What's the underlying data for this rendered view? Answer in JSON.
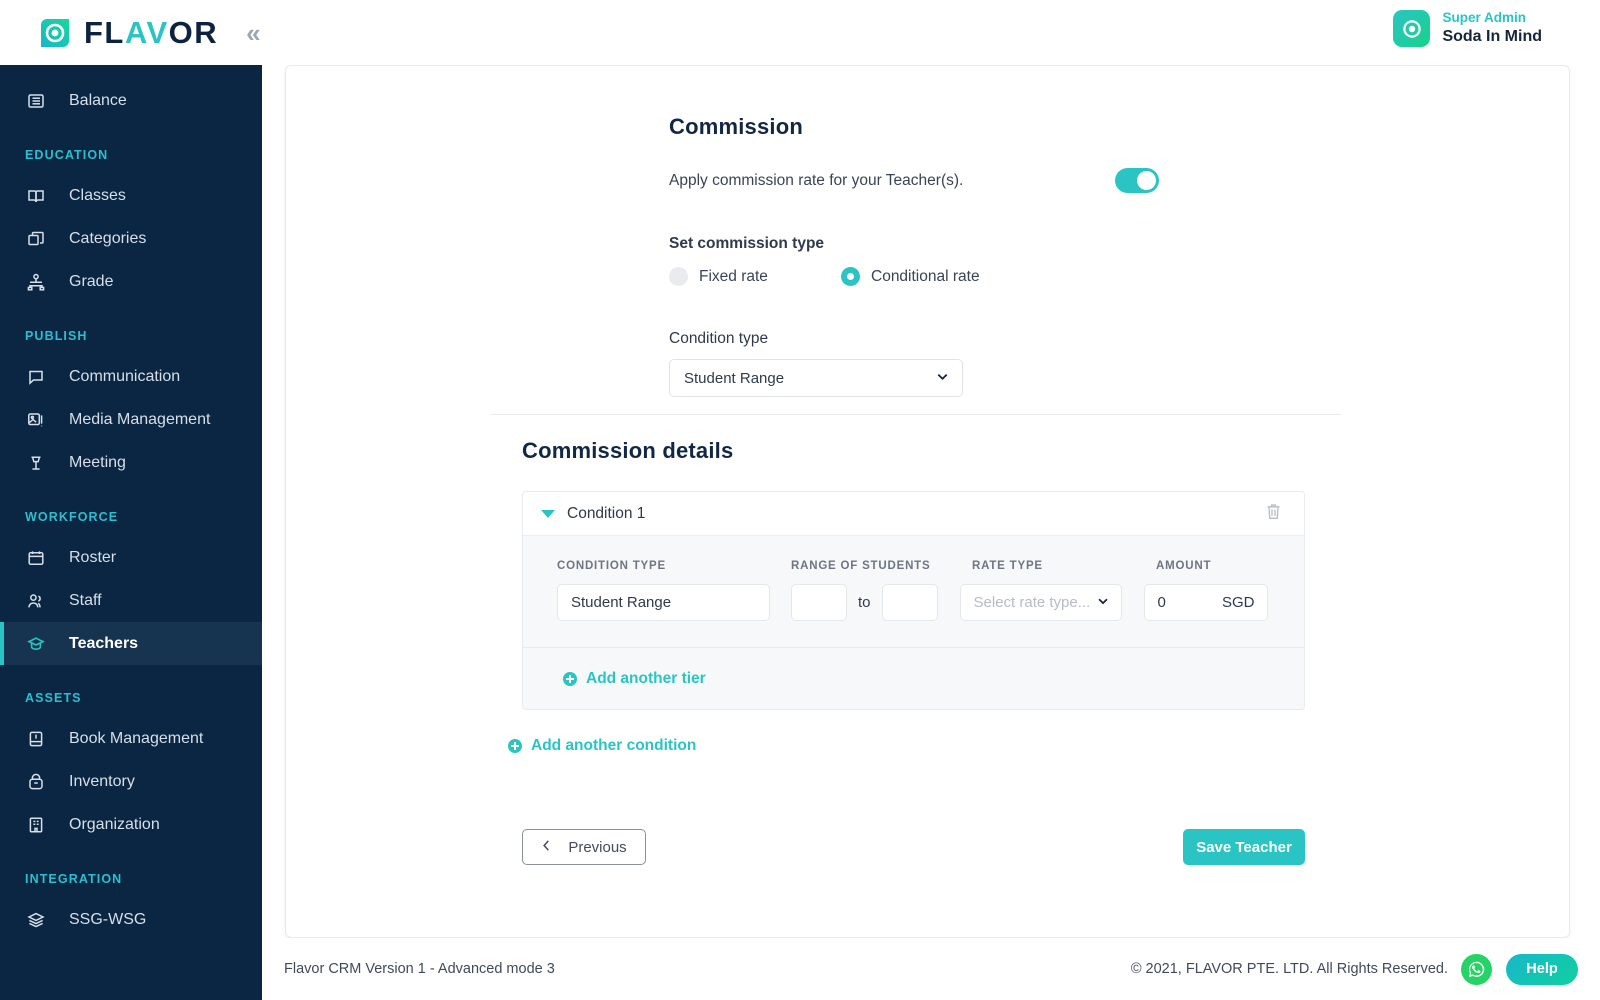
{
  "brand": {
    "name_dark": "FL",
    "name_accent": "AV",
    "name_dark2": "OR",
    "collapse_icon": "«",
    "logo_icon": "flavor-logo-icon"
  },
  "user": {
    "role": "Super Admin",
    "name": "Soda In Mind"
  },
  "sidebar": {
    "items": [
      {
        "label": "Balance",
        "icon": "balance-icon",
        "type": "item",
        "active": false
      },
      {
        "label": "EDUCATION",
        "type": "group"
      },
      {
        "label": "Classes",
        "icon": "classes-icon",
        "type": "item",
        "active": false
      },
      {
        "label": "Categories",
        "icon": "categories-icon",
        "type": "item",
        "active": false
      },
      {
        "label": "Grade",
        "icon": "grade-icon",
        "type": "item",
        "active": false
      },
      {
        "label": "PUBLISH",
        "type": "group"
      },
      {
        "label": "Communication",
        "icon": "communication-icon",
        "type": "item",
        "active": false
      },
      {
        "label": "Media Management",
        "icon": "media-management-icon",
        "type": "item",
        "active": false
      },
      {
        "label": "Meeting",
        "icon": "meeting-icon",
        "type": "item",
        "active": false
      },
      {
        "label": "WORKFORCE",
        "type": "group"
      },
      {
        "label": "Roster",
        "icon": "roster-icon",
        "type": "item",
        "active": false
      },
      {
        "label": "Staff",
        "icon": "staff-icon",
        "type": "item",
        "active": false
      },
      {
        "label": "Teachers",
        "icon": "teachers-icon",
        "type": "item",
        "active": true
      },
      {
        "label": "ASSETS",
        "type": "group"
      },
      {
        "label": "Book Management",
        "icon": "book-management-icon",
        "type": "item",
        "active": false
      },
      {
        "label": "Inventory",
        "icon": "inventory-icon",
        "type": "item",
        "active": false
      },
      {
        "label": "Organization",
        "icon": "organization-icon",
        "type": "item",
        "active": false
      },
      {
        "label": "INTEGRATION",
        "type": "group"
      },
      {
        "label": "SSG-WSG",
        "icon": "ssg-wsg-icon",
        "type": "item",
        "active": false
      }
    ]
  },
  "commission": {
    "title": "Commission",
    "toggle_label": "Apply commission rate for your Teacher(s).",
    "toggle_on": true,
    "type_label": "Set commission type",
    "options": [
      {
        "label": "Fixed rate",
        "selected": false
      },
      {
        "label": "Conditional rate",
        "selected": true
      }
    ],
    "condition_type_label": "Condition type",
    "condition_type_value": "Student Range"
  },
  "details": {
    "title": "Commission details",
    "condition_title": "Condition 1",
    "delete_icon": "trash-icon",
    "columns": {
      "condition_type": "CONDITION TYPE",
      "range_of_students": "RANGE OF STUDENTS",
      "rate_type": "RATE TYPE",
      "amount": "AMOUNT"
    },
    "row": {
      "condition_type_value": "Student Range",
      "range_from": "",
      "range_from_placeholder": "",
      "range_to_word": "to",
      "range_to": "",
      "range_to_placeholder": "",
      "rate_type_placeholder": "Select rate type...",
      "amount_value": "0",
      "currency": "SGD"
    },
    "add_tier_label": "Add another tier",
    "add_condition_label": "Add another condition"
  },
  "actions": {
    "previous_label": "Previous",
    "previous_icon": "chevron-left-icon",
    "save_label": "Save Teacher"
  },
  "footer": {
    "version": "Flavor CRM Version 1 - Advanced mode 3",
    "copyright": "© 2021, FLAVOR PTE. LTD. All Rights Reserved.",
    "whatsapp_icon": "whatsapp-icon",
    "help_label": "Help"
  },
  "colors": {
    "accent": "#2bc4c4",
    "sidebar_bg": "#0a2642",
    "sidebar_active_bg": "#16344f",
    "group_label": "#2bbfcf",
    "heading": "#112744",
    "whatsapp_green": "#25d366"
  }
}
